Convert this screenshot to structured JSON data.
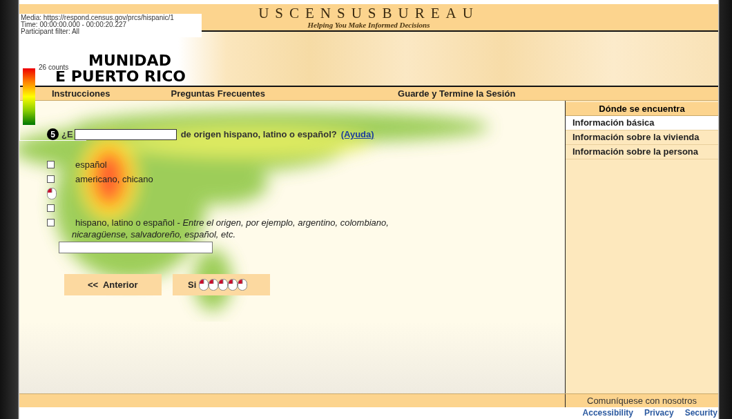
{
  "overlay_info": [
    "Media: https://respond.census.gov/prcs/hispanic/1",
    "Time: 00:00:00.000 - 00:00:20.227",
    "Participant filter: All"
  ],
  "legend": {
    "label": "26 counts"
  },
  "header": {
    "logo": "USCENSUSBUREAU",
    "tagline": "Helping You Make Informed Decisions"
  },
  "banner": {
    "title_lines": [
      "MUNIDAD",
      "E PUERTO RICO"
    ]
  },
  "nav": [
    "Instrucciones",
    "Preguntas Frecuentes",
    "Guarde y Termine la Sesión"
  ],
  "question": {
    "number": "5",
    "lead": "¿E",
    "text": "de origen hispano, latino o español?",
    "help_link": "(Ayuda)"
  },
  "options": [
    {
      "kind": "checkbox",
      "checked": false,
      "text": "español"
    },
    {
      "kind": "checkbox",
      "checked": false,
      "text": "americano, chicano"
    },
    {
      "kind": "click"
    },
    {
      "kind": "checkbox",
      "checked": false
    },
    {
      "kind": "checkbox",
      "checked": false,
      "text": "hispano, latino o español - *Entre el origen, por ejemplo, argentino, colombiano,*",
      "note": "nicaragüense, salvadoreño, español, etc."
    }
  ],
  "buttons": [
    {
      "kind": "prev",
      "label": "<<  Anterior"
    },
    {
      "kind": "next",
      "label": "Si"
    }
  ],
  "sidebar": {
    "title": "Dónde se encuentra",
    "items": [
      {
        "label": "Información básica",
        "selected": true
      },
      {
        "label": "Información sobre la vivienda",
        "selected": false
      },
      {
        "label": "Información sobre la persona",
        "selected": false
      }
    ]
  },
  "footer": {
    "contact": "Comuníquese con nosotros",
    "links": [
      "Accessibility",
      "Privacy",
      "Security"
    ]
  }
}
